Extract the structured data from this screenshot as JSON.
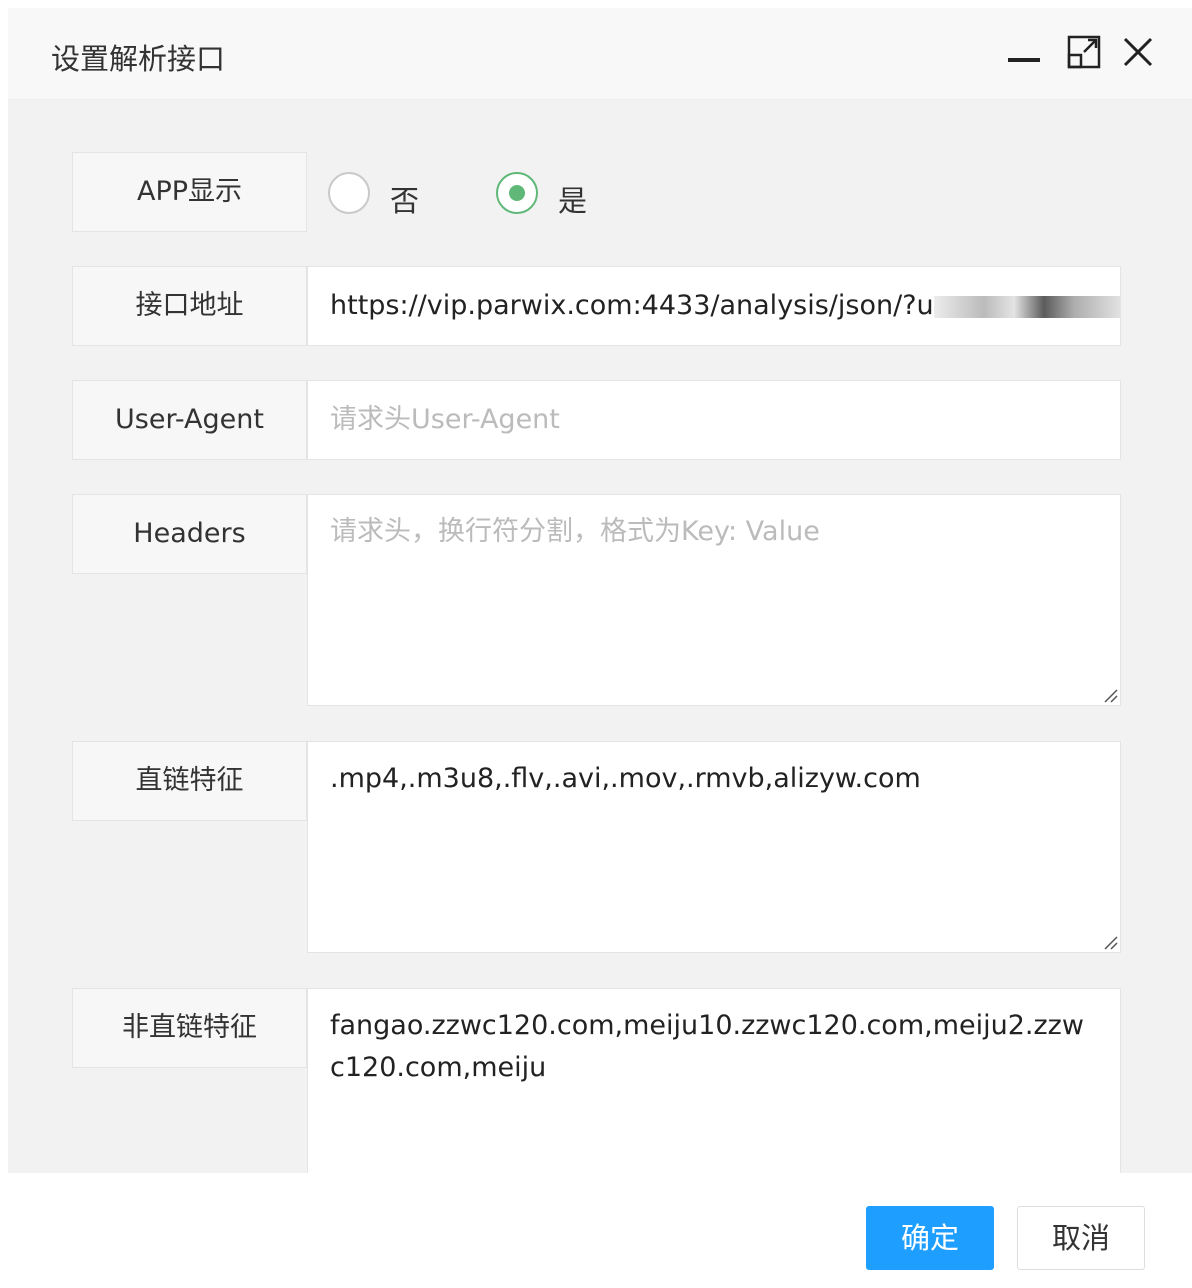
{
  "dialog": {
    "title": "设置解析接口",
    "minimize_icon": "minimize-icon",
    "maximize_icon": "maximize-icon",
    "close_icon": "close-icon"
  },
  "form": {
    "app_display": {
      "label": "APP显示",
      "options": [
        {
          "label": "否",
          "selected": false
        },
        {
          "label": "是",
          "selected": true
        }
      ],
      "accent_color": "#5fb878"
    },
    "api_url": {
      "label": "接口地址",
      "value": "https://vip.parwix.com:4433/analysis/json/?u"
    },
    "user_agent": {
      "label": "User-Agent",
      "value": "",
      "placeholder": "请求头User-Agent"
    },
    "headers": {
      "label": "Headers",
      "value": "",
      "placeholder": "请求头，换行符分割，格式为Key: Value"
    },
    "direct_link": {
      "label": "直链特征",
      "value": ".mp4,.m3u8,.flv,.avi,.mov,.rmvb,alizyw.com"
    },
    "non_direct_link": {
      "label": "非直链特征",
      "value": "fangao.zzwc120.com,meiju10.zzwc120.com,meiju2.zzwc120.com,meiju"
    }
  },
  "footer": {
    "confirm_label": "确定",
    "cancel_label": "取消",
    "confirm_color": "#1e9fff"
  }
}
